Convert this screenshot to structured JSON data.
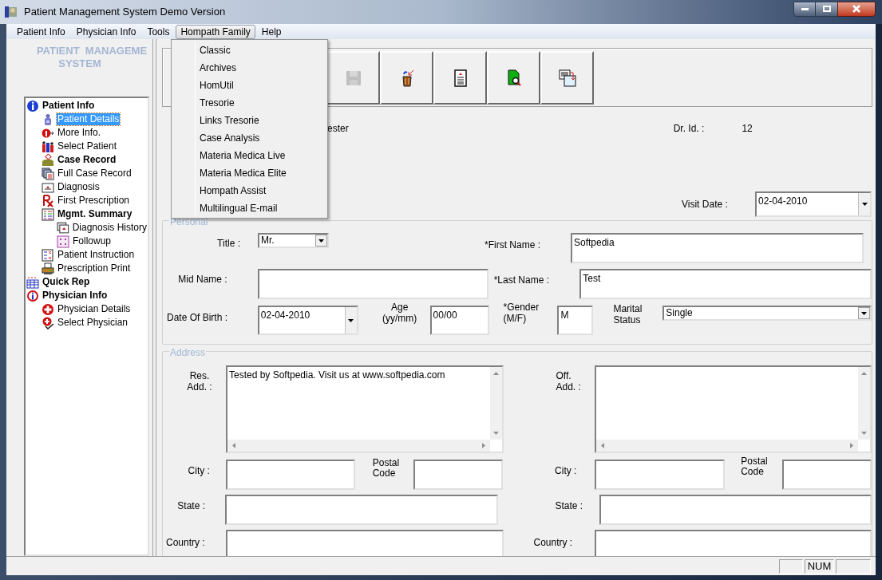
{
  "window": {
    "title": "Patient Management System Demo Version"
  },
  "menu_bar": [
    {
      "label": "Patient Info",
      "selected": false
    },
    {
      "label": "Physician Info",
      "selected": false
    },
    {
      "label": "Tools",
      "selected": false
    },
    {
      "label": "Hompath Family",
      "selected": true
    },
    {
      "label": "Help",
      "selected": false
    }
  ],
  "open_menu": {
    "items": [
      "Classic",
      "Archives",
      "HomUtil",
      "Tresorie",
      "Links Tresorie",
      "Case Analysis",
      "Materia Medica Live",
      "Materia Medica Elite",
      "Hompath Assist",
      "Multilingual E-mail"
    ]
  },
  "logo": {
    "lines": [
      "PATIENT  MANAGEME",
      "SYSTEM"
    ]
  },
  "tree": [
    {
      "label": "Patient Info",
      "bold": true,
      "selected": false,
      "children": [
        {
          "label": "Patient Details",
          "bold": false,
          "selected": true
        },
        {
          "label": "More Info.",
          "bold": false,
          "selected": false
        },
        {
          "label": "Select Patient",
          "bold": false,
          "selected": false
        },
        {
          "label": "Case Record",
          "bold": true,
          "selected": false
        },
        {
          "label": "Full Case Record",
          "bold": false,
          "selected": false
        },
        {
          "label": "Diagnosis",
          "bold": false,
          "selected": false
        },
        {
          "label": "First Prescription",
          "bold": false,
          "selected": false
        },
        {
          "label": "Mgmt. Summary",
          "bold": true,
          "selected": false,
          "children": [
            {
              "label": "Diagnosis History",
              "bold": false,
              "selected": false
            },
            {
              "label": "Followup",
              "bold": false,
              "selected": false
            }
          ]
        },
        {
          "label": "Patient Instruction",
          "bold": false,
          "selected": false
        },
        {
          "label": "Prescription Print",
          "bold": false,
          "selected": false
        }
      ]
    },
    {
      "label": "Quick Rep",
      "bold": true,
      "selected": false
    },
    {
      "label": "Physician Info",
      "bold": true,
      "selected": false,
      "children": [
        {
          "label": "Physician Details",
          "bold": false,
          "selected": false
        },
        {
          "label": "Select Physician",
          "bold": false,
          "selected": false
        }
      ]
    }
  ],
  "toolbar": {
    "buttons": [
      {
        "disabled": true
      },
      {
        "disabled": false
      },
      {
        "disabled": false
      },
      {
        "disabled": false
      },
      {
        "disabled": false
      }
    ]
  },
  "header": {
    "partial_text": "ester",
    "dr_id_label": "Dr. Id. :",
    "dr_id": "12",
    "visit_date_label": "Visit Date :",
    "visit_date": "02-04-2010"
  },
  "personal": {
    "legend": "Personal",
    "title_label": "Title :",
    "title": "Mr.",
    "first_name_label": "*First Name :",
    "first_name": "Softpedia",
    "mid_name_label": "Mid Name :",
    "last_name_label": "*Last Name :",
    "last_name": "Test",
    "dob_label": "Date Of Birth :",
    "dob": "02-04-2010",
    "age_label": "Age (yy/mm)",
    "age": "00/00",
    "gender_label": "*Gender (M/F)",
    "gender": "M",
    "marital_label": "Marital Status",
    "marital": "Single"
  },
  "address": {
    "legend": "Address",
    "res_label": "Res. Add. :",
    "res": "Tested by Softpedia. Visit us at www.softpedia.com",
    "off_label": "Off. Add. :",
    "city_label": "City :",
    "postal_label": "Postal Code",
    "state_label": "State :",
    "country_label": "Country :",
    "off_city_label": "City :",
    "off_postal_label": "Postal Code",
    "off_state_label": "State :",
    "off_country_label": "Country :"
  },
  "status_bar": {
    "num_indicator": "NUM"
  }
}
